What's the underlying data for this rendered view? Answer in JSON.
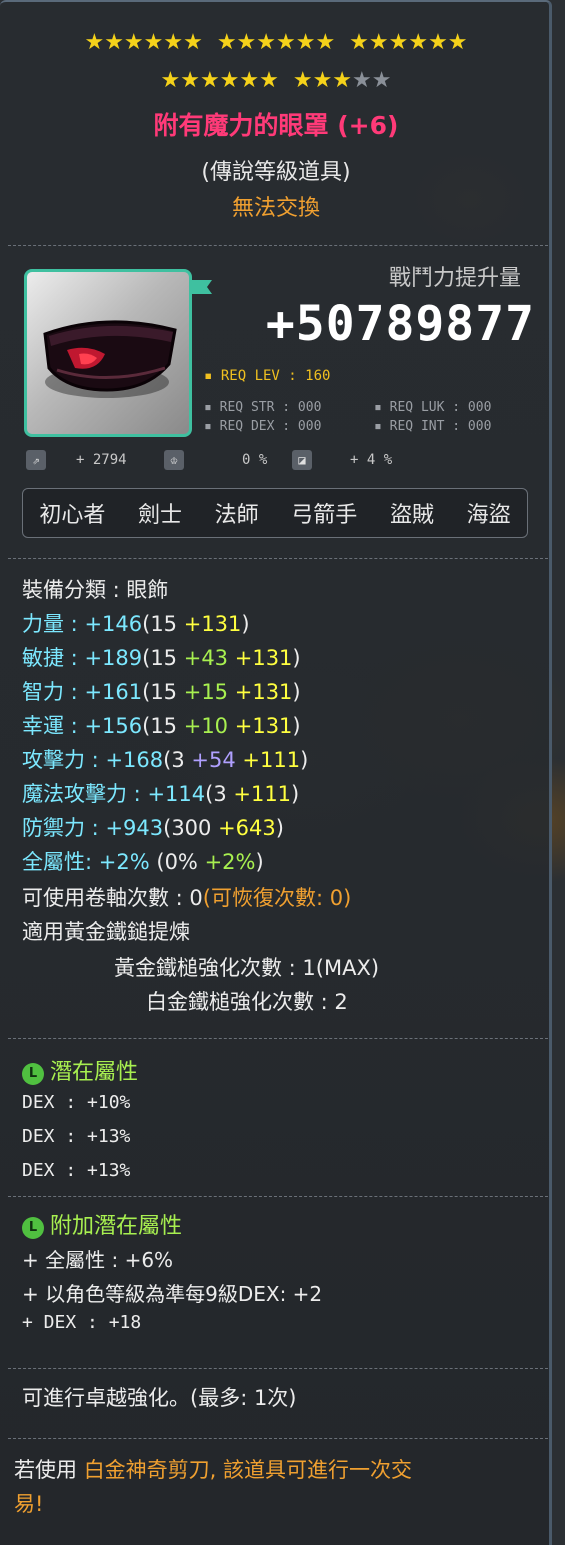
{
  "stars": {
    "row1": [
      "★★★★★★",
      "★★★★★★",
      "★★★★★★"
    ],
    "row2_filled_a": "★★★★★★",
    "row2_filled_b": "★★★",
    "row2_empty": "★★",
    "total": 25,
    "filled": 23
  },
  "item": {
    "name": "附有魔力的眼罩 (+6)",
    "grade": "(傳說等級道具)",
    "trade": "無法交換"
  },
  "power": {
    "label": "戰鬥力提升量",
    "value": "+50789877"
  },
  "requirements": {
    "lev": "REQ LEV : 160",
    "str": "REQ STR : 000",
    "luk": "REQ LUK : 000",
    "dex": "REQ DEX : 000",
    "int": "REQ INT : 000"
  },
  "meta": {
    "count_value": "+ 2794",
    "percent_value": "0 %",
    "bonus_value": "+ 4 %"
  },
  "jobs": [
    "初心者",
    "劍士",
    "法師",
    "弓箭手",
    "盜賊",
    "海盜"
  ],
  "stats": {
    "category": "裝備分類 : 眼飾",
    "str": {
      "label": "力量",
      "sep": " : ",
      "total": "+146",
      "base": "(15 ",
      "star": "+131",
      "close": ")"
    },
    "dex": {
      "label": "敏捷",
      "sep": " : ",
      "total": "+189",
      "base": "(15 ",
      "flame": "+43",
      "star": "+131",
      "close": ")"
    },
    "int": {
      "label": "智力",
      "sep": " : ",
      "total": "+161",
      "base": "(15 ",
      "flame": "+15",
      "star": "+131",
      "close": ")"
    },
    "luk": {
      "label": "幸運",
      "sep": " : ",
      "total": "+156",
      "base": "(15 ",
      "flame": "+10",
      "star": "+131",
      "close": ")"
    },
    "att": {
      "label": "攻擊力",
      "sep": " : ",
      "total": "+168",
      "base": "(3 ",
      "scroll": "+54",
      "star": "+111",
      "close": ")"
    },
    "matt": {
      "label": "魔法攻擊力",
      "sep": " : ",
      "total": "+114",
      "base": "(3 ",
      "star": "+111",
      "close": ")"
    },
    "def": {
      "label": "防禦力",
      "sep": " : ",
      "total": "+943",
      "base": "(300 ",
      "star": "+643",
      "close": ")"
    },
    "all": {
      "label": "全屬性",
      "sep": ": ",
      "total": "+2%",
      "base": "(0% ",
      "flame": "+2%",
      "close": ")"
    },
    "scroll_count": "可使用卷軸次數 : 0",
    "recover_count": "(可恢復次數: 0)",
    "hammer_apply": "適用黃金鐵鎚提煉",
    "gold_hammer": "黃金鐵槌強化次數 : 1(MAX)",
    "platinum_hammer": "白金鐵槌強化次數 : 2"
  },
  "potential": {
    "title": "潛在屬性",
    "lines": [
      "DEX : +10%",
      "DEX : +13%",
      "DEX : +13%"
    ]
  },
  "bonus_potential": {
    "title": "附加潛在屬性",
    "lines": [
      "+ 全屬性 : +6%",
      "+ 以角色等級為準每9級DEX: +2",
      "+ DEX : +18"
    ]
  },
  "transcend": "可進行卓越強化。(最多: 1次)",
  "karma": {
    "prefix": "若使用 ",
    "highlight": "白金神奇剪刀, 該道具可進行一次交",
    "line2": "易!"
  },
  "colors": {
    "title": "#ff3a78",
    "trade": "#f0a030",
    "stat_cyan": "#7ce8ff",
    "flame_green": "#a8f050",
    "star_yellow": "#ffff40",
    "potential_green": "#a8f050"
  }
}
